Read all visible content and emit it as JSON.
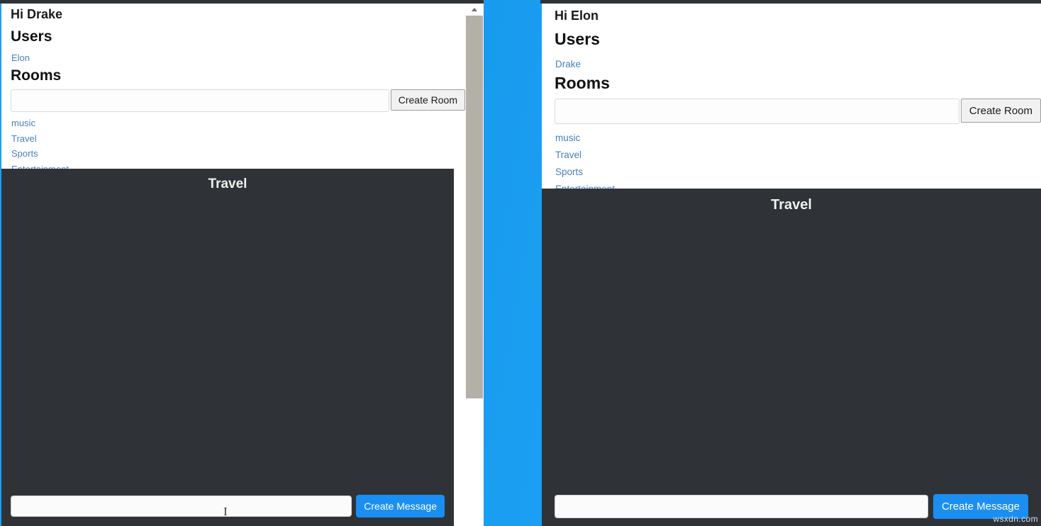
{
  "app": {
    "users_heading": "Users",
    "rooms_heading": "Rooms",
    "create_room_label": "Create Room",
    "create_message_label": "Create Message",
    "room_input_value": "",
    "room_input_placeholder": "",
    "message_input_value": "",
    "message_input_placeholder": "",
    "rooms": [
      "music",
      "Travel",
      "Sports",
      "Entertainment"
    ]
  },
  "colors": {
    "desktop_blue": "#1b9ff2",
    "chat_dark": "#2f3337",
    "link_blue": "#4a7fbc",
    "primary_button": "#1b8ef2",
    "window_topbar": "#2f3337"
  },
  "left_window": {
    "greeting": "Hi Drake",
    "users_heading": "Users",
    "users": [
      "Elon"
    ],
    "rooms_heading": "Rooms",
    "rooms": [
      "music",
      "Travel",
      "Sports",
      "Entertainment"
    ],
    "create_room_label": "Create Room",
    "room_input_value": "",
    "active_room_title": "Travel",
    "messages": [],
    "message_input_value": "",
    "create_message_label": "Create Message"
  },
  "right_window": {
    "greeting": "Hi Elon",
    "users_heading": "Users",
    "users": [
      "Drake"
    ],
    "rooms_heading": "Rooms",
    "rooms": [
      "music",
      "Travel",
      "Sports",
      "Entertainment"
    ],
    "create_room_label": "Create Room",
    "room_input_value": "",
    "active_room_title": "Travel",
    "messages": [],
    "message_input_value": "",
    "create_message_label": "Create Message"
  },
  "watermark": {
    "text": "wsxdn.com"
  },
  "cursor": {
    "glyph": "I"
  }
}
